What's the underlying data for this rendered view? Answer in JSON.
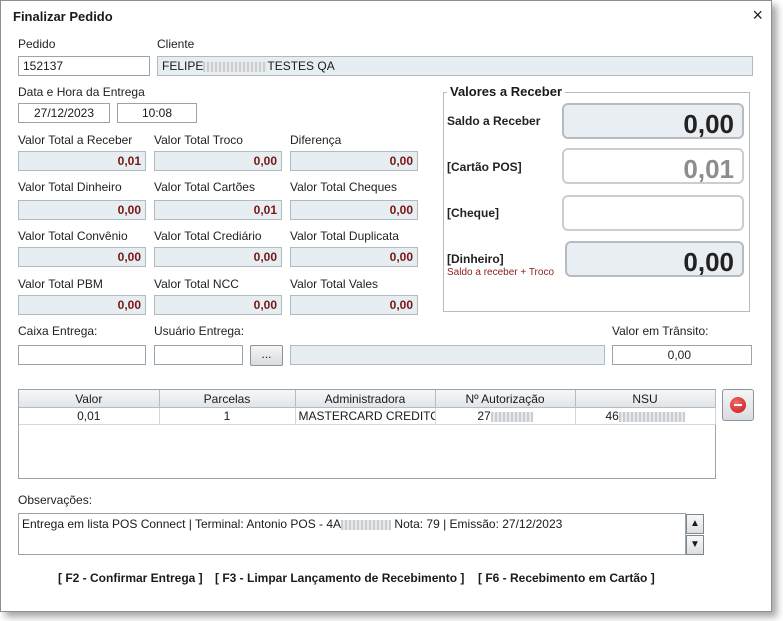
{
  "window": {
    "title": "Finalizar Pedido",
    "close": "×"
  },
  "pedido": {
    "label": "Pedido",
    "value": "152137"
  },
  "cliente": {
    "label": "Cliente",
    "value_start": "FELIPE",
    "value_end": "TESTES QA"
  },
  "entrega": {
    "label": "Data e Hora da Entrega",
    "date": "27/12/2023",
    "time": "10:08"
  },
  "totals": {
    "receber": {
      "label": "Valor Total a Receber",
      "value": "0,01"
    },
    "troco": {
      "label": "Valor Total Troco",
      "value": "0,00"
    },
    "diferenca": {
      "label": "Diferença",
      "value": "0,00"
    },
    "dinheiro": {
      "label": "Valor Total Dinheiro",
      "value": "0,00"
    },
    "cartoes": {
      "label": "Valor Total Cartões",
      "value": "0,01"
    },
    "cheques": {
      "label": "Valor Total Cheques",
      "value": "0,00"
    },
    "convenio": {
      "label": "Valor Total Convênio",
      "value": "0,00"
    },
    "crediario": {
      "label": "Valor Total Crediário",
      "value": "0,00"
    },
    "duplicata": {
      "label": "Valor Total Duplicata",
      "value": "0,00"
    },
    "pbm": {
      "label": "Valor Total PBM",
      "value": "0,00"
    },
    "ncc": {
      "label": "Valor Total NCC",
      "value": "0,00"
    },
    "vales": {
      "label": "Valor Total Vales",
      "value": "0,00"
    }
  },
  "valores": {
    "title": "Valores a Receber",
    "saldo": {
      "label": "Saldo a Receber",
      "value": "0,00"
    },
    "cartao_pos": {
      "label": "[Cartão POS]",
      "value": "0,01"
    },
    "cheque": {
      "label": "[Cheque]",
      "value": ""
    },
    "dinheiro": {
      "label": "[Dinheiro]",
      "sublabel": "Saldo a receber + Troco",
      "value": "0,00"
    }
  },
  "caixa_entrega": {
    "label": "Caixa Entrega:",
    "value": ""
  },
  "usuario_entrega": {
    "label": "Usuário Entrega:",
    "value": "",
    "button": "..."
  },
  "transito": {
    "label": "Valor em Trânsito:",
    "value": "0,00"
  },
  "grid": {
    "columns": [
      "Valor",
      "Parcelas",
      "Administradora",
      "Nº Autorização",
      "NSU"
    ],
    "rows": [
      {
        "valor": "0,01",
        "parcelas": "1",
        "administradora": "MASTERCARD CREDITO...",
        "autorizacao": "27",
        "nsu": "46"
      }
    ]
  },
  "observacoes": {
    "label": "Observações:",
    "text_start": "Entrega em lista POS Connect | Terminal: Antonio POS - 4A",
    "text_end": "Nota: 79 | Emissão: 27/12/2023"
  },
  "actions": {
    "confirmar": "[ F2 - Confirmar Entrega ]",
    "limpar": "[ F3 - Limpar Lançamento de Recebimento ]",
    "cartao": "[ F6 - Recebimento em  Cartão ]"
  },
  "icons": {
    "remove": "remove-circle-icon",
    "scroll_up": "▲",
    "scroll_down": "▼"
  }
}
